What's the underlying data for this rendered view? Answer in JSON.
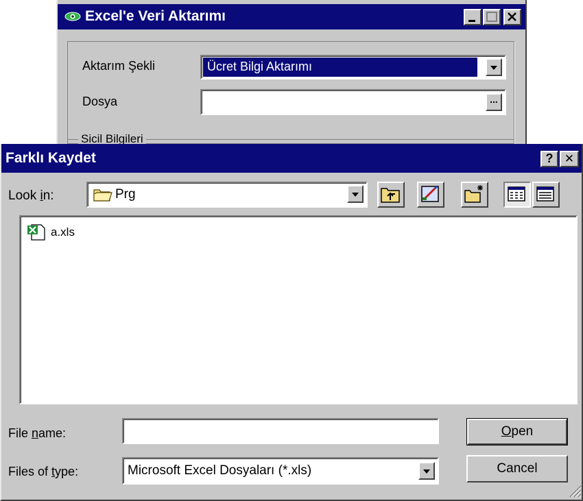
{
  "background_window": {
    "title": "Excel'e Veri Aktarımı",
    "aktarim_label": "Aktarım Şekli",
    "aktarim_value": "Ücret Bilgi Aktarımı",
    "dosya_label": "Dosya",
    "dosya_value": "",
    "browse_label": "...",
    "group_label": "Sicil Bilgileri"
  },
  "dialog": {
    "title": "Farklı Kaydet",
    "help_label": "?",
    "close_label": "✕",
    "lookin_prefix": "Look ",
    "lookin_accel": "i",
    "lookin_suffix": "n:",
    "lookin_value": "Prg",
    "files": [
      {
        "name": "a.xls",
        "icon": "excel-file-icon"
      }
    ],
    "filename_prefix": "File ",
    "filename_accel": "n",
    "filename_suffix": "ame:",
    "filename_value": "",
    "filetype_prefix": "Files of ",
    "filetype_accel": "t",
    "filetype_suffix": "ype:",
    "filetype_value": "Microsoft Excel Dosyaları (*.xls)",
    "open_accel": "O",
    "open_rest": "pen",
    "cancel_label": "Cancel"
  },
  "colors": {
    "titlebar": "#0a0a7a",
    "face": "#c8c8c8",
    "selection": "#0a0a7a"
  },
  "icons": [
    "eye-icon",
    "folder-icon",
    "up-folder-icon",
    "desktop-icon",
    "new-folder-icon",
    "list-view-icon",
    "details-view-icon",
    "excel-file-icon",
    "chevron-down-icon",
    "resize-grip-icon"
  ]
}
